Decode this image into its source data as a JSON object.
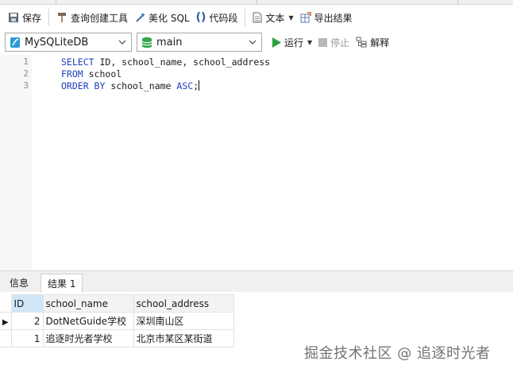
{
  "toolbar": {
    "save_label": "保存",
    "query_builder_label": "查询创建工具",
    "beautify_label": "美化 SQL",
    "snippet_label": "代码段",
    "text_label": "文本",
    "export_label": "导出结果"
  },
  "toolbar2": {
    "connection": "MySQLiteDB",
    "database": "main",
    "run_label": "运行",
    "stop_label": "停止",
    "explain_label": "解释"
  },
  "editor": {
    "line_numbers": [
      "1",
      "2",
      "3"
    ],
    "line1_kw1": "SELECT",
    "line1_rest": " ID, school_name, school_address",
    "line2_kw1": "FROM",
    "line2_rest": " school",
    "line3_kw1": "ORDER BY",
    "line3_mid": " school_name ",
    "line3_kw2": "ASC",
    "line3_end": ";"
  },
  "results": {
    "tabs": [
      "信息",
      "结果 1"
    ],
    "columns": [
      "ID",
      "school_name",
      "school_address"
    ],
    "rows": [
      {
        "id": "2",
        "school_name": "DotNetGuide学校",
        "school_address": "深圳南山区"
      },
      {
        "id": "1",
        "school_name": "追逐时光者学校",
        "school_address": "北京市某区某街道"
      }
    ]
  },
  "watermark": "掘金技术社区 @ 追逐时光者",
  "colors": {
    "keyword": "#1f3fbf",
    "selected_header": "#cfe6f7",
    "run_green": "#2ea043"
  }
}
